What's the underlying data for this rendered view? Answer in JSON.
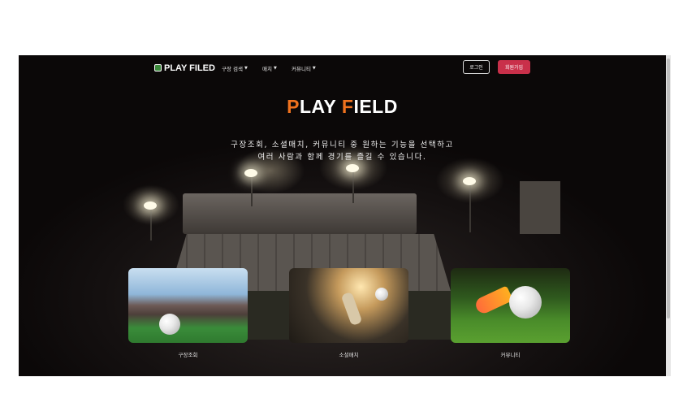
{
  "nav": {
    "logo_text": "PLAY FILED",
    "menus": [
      {
        "label": "구장 검색"
      },
      {
        "label": "매치"
      },
      {
        "label": "커뮤니티"
      }
    ],
    "login_label": "로그인",
    "signup_label": "회원가입"
  },
  "hero": {
    "title_p": "P",
    "title_lay": "LAY ",
    "title_f": "F",
    "title_ield": "IELD",
    "subtitle_line1": "구장조회, 소셜매치, 커뮤니티 중 원하는 기능을 선택하고",
    "subtitle_line2": "여러 사람과 함께 경기를 즐길 수 있습니다."
  },
  "cards": [
    {
      "label": "구장조회"
    },
    {
      "label": "소셜매치"
    },
    {
      "label": "커뮤니티"
    }
  ],
  "colors": {
    "accent_orange": "#f0721e",
    "signup_red": "#c9304a"
  }
}
